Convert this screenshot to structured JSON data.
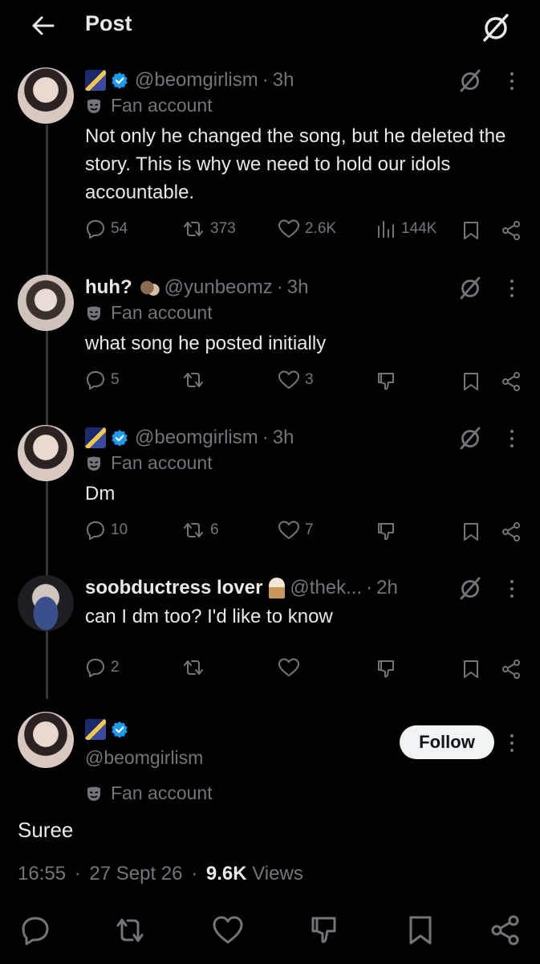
{
  "header": {
    "title": "Post"
  },
  "replies": [
    {
      "display_name": "",
      "handle": "@beomgirlism",
      "time": "3h",
      "fan_label": "Fan account",
      "text": "Not only he changed the song, but he deleted the story. This is why we need to hold our idols accountable.",
      "stats": {
        "replies": "54",
        "reposts": "373",
        "likes": "2.6K",
        "views": "144K"
      }
    },
    {
      "display_name": "huh?",
      "handle": "@yunbeomz",
      "time": "3h",
      "fan_label": "Fan account",
      "text": "what song he posted initially",
      "stats": {
        "replies": "5",
        "reposts": "",
        "likes": "3"
      }
    },
    {
      "display_name": "",
      "handle": "@beomgirlism",
      "time": "3h",
      "fan_label": "Fan account",
      "text": "Dm",
      "stats": {
        "replies": "10",
        "reposts": "6",
        "likes": "7"
      }
    },
    {
      "display_name": "soobductress lover",
      "handle": "@thek...",
      "time": "2h",
      "text": "can I dm too? I'd like to know",
      "stats": {
        "replies": "2",
        "reposts": "",
        "likes": ""
      }
    }
  ],
  "main_post": {
    "handle": "@beomgirlism",
    "fan_label": "Fan account",
    "follow_label": "Follow",
    "text": "Suree",
    "time": "16:55",
    "date": "27 Sept 26",
    "views_count": "9.6K",
    "views_label": "Views"
  },
  "separator": "·",
  "colors": {
    "background": "#000000",
    "text": "#e7e9ea",
    "muted": "#71767b",
    "verified": "#1d9bf0"
  },
  "icons": [
    "back-arrow-icon",
    "grok-icon",
    "verified-icon",
    "mask-icon",
    "reply-icon",
    "repost-icon",
    "like-icon",
    "views-icon",
    "bookmark-icon",
    "share-icon",
    "dislike-icon",
    "more-icon"
  ]
}
